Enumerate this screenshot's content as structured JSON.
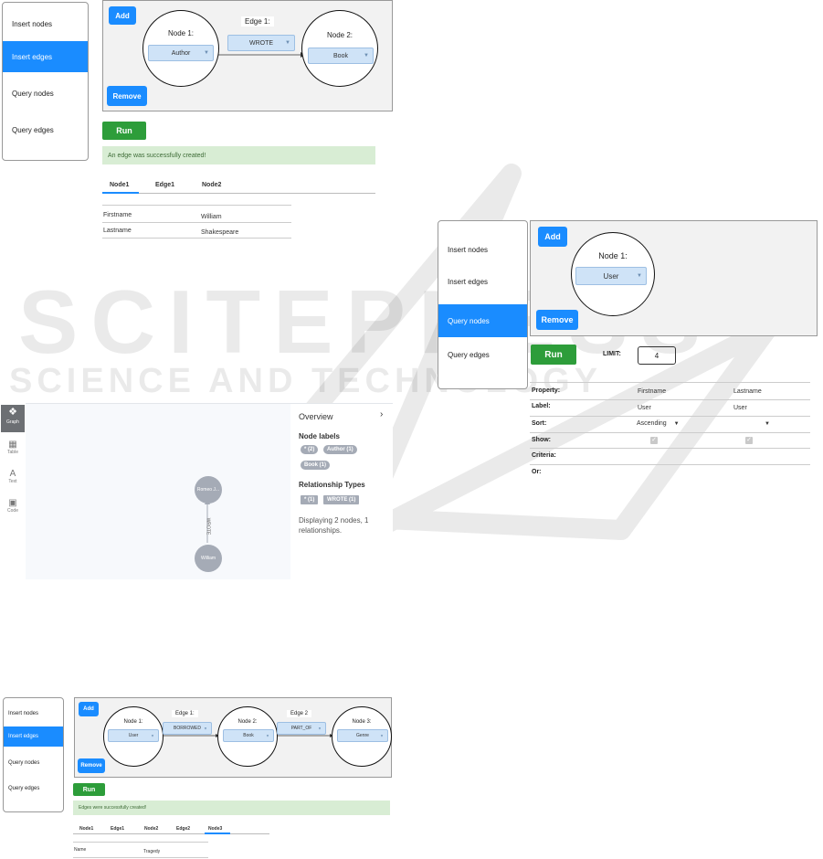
{
  "nav": {
    "insert_nodes": "Insert nodes",
    "insert_edges": "Insert edges",
    "query_nodes": "Query nodes",
    "query_edges": "Query edges"
  },
  "panel1": {
    "add": "Add",
    "remove": "Remove",
    "node1_title": "Node 1:",
    "node1_value": "Author",
    "edge1_title": "Edge 1:",
    "edge1_value": "WROTE",
    "node2_title": "Node 2:",
    "node2_value": "Book",
    "run": "Run",
    "alert": "An edge was successfully created!",
    "tabs": [
      "Node1",
      "Edge1",
      "Node2"
    ],
    "rows": [
      {
        "key": "Firstname",
        "value": "William"
      },
      {
        "key": "Lastname",
        "value": "Shakespeare"
      }
    ]
  },
  "panel2": {
    "add": "Add",
    "remove": "Remove",
    "node1_title": "Node 1:",
    "node1_value": "User",
    "run": "Run",
    "limit_label": "LIMIT:",
    "limit_value": "4",
    "rows": {
      "property": {
        "label": "Property:",
        "c1": "Firstname",
        "c2": "Lastname"
      },
      "label": {
        "label": "Label:",
        "c1": "User",
        "c2": "User"
      },
      "sort": {
        "label": "Sort:",
        "c1": "Ascending",
        "c2": ""
      },
      "show": {
        "label": "Show:"
      },
      "criteria": {
        "label": "Criteria:"
      },
      "or": {
        "label": "Or:"
      }
    }
  },
  "neo4j": {
    "side": [
      "Graph",
      "Table",
      "Text",
      "Code"
    ],
    "overview": "Overview",
    "node_labels": "Node labels",
    "labels": [
      "* (2)",
      "Author (1)",
      "Book (1)"
    ],
    "rel_types": "Relationship Types",
    "rels": [
      "* (1)",
      "WROTE (1)"
    ],
    "summary": "Displaying 2 nodes, 1 relationships.",
    "node_top": "Romeo J...",
    "node_bottom": "William",
    "edge_label": "WROTE"
  },
  "panel3": {
    "add": "Add",
    "remove": "Remove",
    "node1_title": "Node 1:",
    "node1_value": "User",
    "edge1_title": "Edge 1:",
    "edge1_value": "BORROWED",
    "node2_title": "Node 2:",
    "node2_value": "Book",
    "edge2_title": "Edge 2",
    "edge2_value": "PART_OF",
    "node3_title": "Node 3:",
    "node3_value": "Genre",
    "run": "Run",
    "alert": "Edges were successfully created!",
    "tabs": [
      "Node1",
      "Edge1",
      "Node2",
      "Edge2",
      "Node3"
    ],
    "rows": [
      {
        "key": "Name",
        "value": "Tragedy"
      }
    ]
  },
  "watermark": {
    "big": "SCITEPRESS",
    "small": "SCIENCE AND TECHNOLOGY PUBLICATIONS"
  },
  "colors": {
    "primary": "#1a8cff",
    "success": "#2d9d3a",
    "alert_bg": "#d8edd4"
  }
}
